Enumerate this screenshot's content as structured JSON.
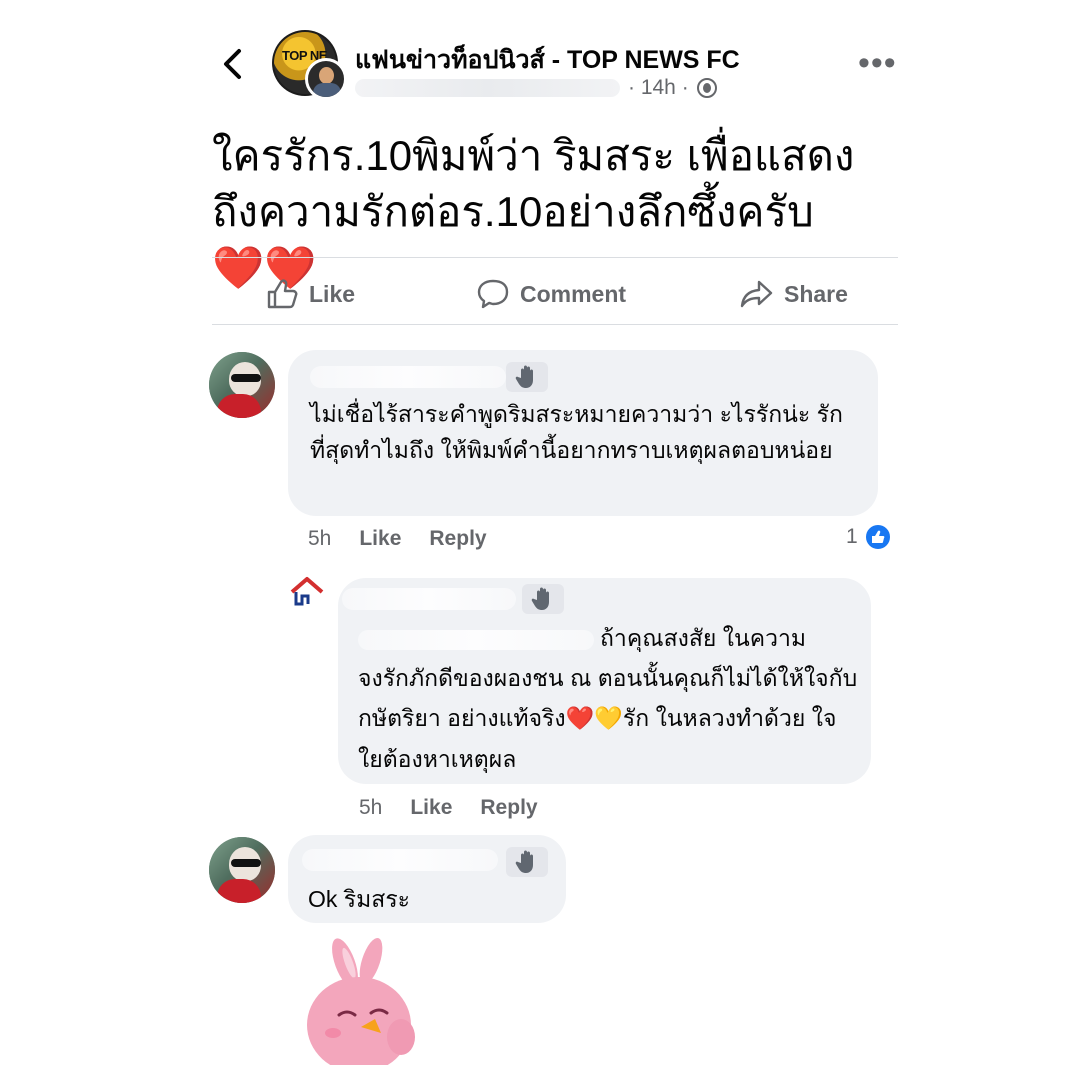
{
  "header": {
    "page_name": "แฟนข่าวท็อปนิวส์ - TOP NEWS FC",
    "avatar_logo": "TOP NE",
    "time": "· 14h ·",
    "back_icon": "chevron-left-icon",
    "more_icon": "more-horizontal-icon",
    "more_label": "•••",
    "audience_icon": "globe-icon"
  },
  "post": {
    "text": "ใครรักร.10พิมพ์ว่า ริมสระ เพื่อแสดงถึงความรักต่อร.10อย่างลึกซึ้งครับ",
    "emoji": "❤️❤️"
  },
  "actions": {
    "like": "Like",
    "comment": "Comment",
    "share": "Share"
  },
  "comments": [
    {
      "text": "ไม่เชื่อไร้สาระคำพูดริมสระหมายความว่า ะไรรักน่ะ รักที่สุดทำไมถึง ให้พิมพ์คำนี้อยากทราบเหตุผลตอบหน่อย",
      "time": "5h",
      "like": "Like",
      "reply": "Reply",
      "reaction_count": "1"
    },
    {
      "text_first_line": "ถ้าคุณสงสัย ในความ",
      "text_rest": "จงรักภักดีของผองชน ณ ตอนนั้นคุณก็ไม่ได้ให้ใจกับกษัตริยา อย่างแท้จริง",
      "emoji": "❤️💛",
      "text_after_emoji": "รัก ในหลวงทำด้วย ใจ ใยต้องหาเหตุผล",
      "time": "5h",
      "like": "Like",
      "reply": "Reply"
    },
    {
      "text": "Ok ริมสระ",
      "time": "",
      "like": "",
      "reply": ""
    }
  ],
  "colors": {
    "text_primary": "#050505",
    "text_secondary": "#65676b",
    "bubble_bg": "#f0f2f5",
    "like_blue": "#1877f2",
    "divider": "#dadde1"
  }
}
